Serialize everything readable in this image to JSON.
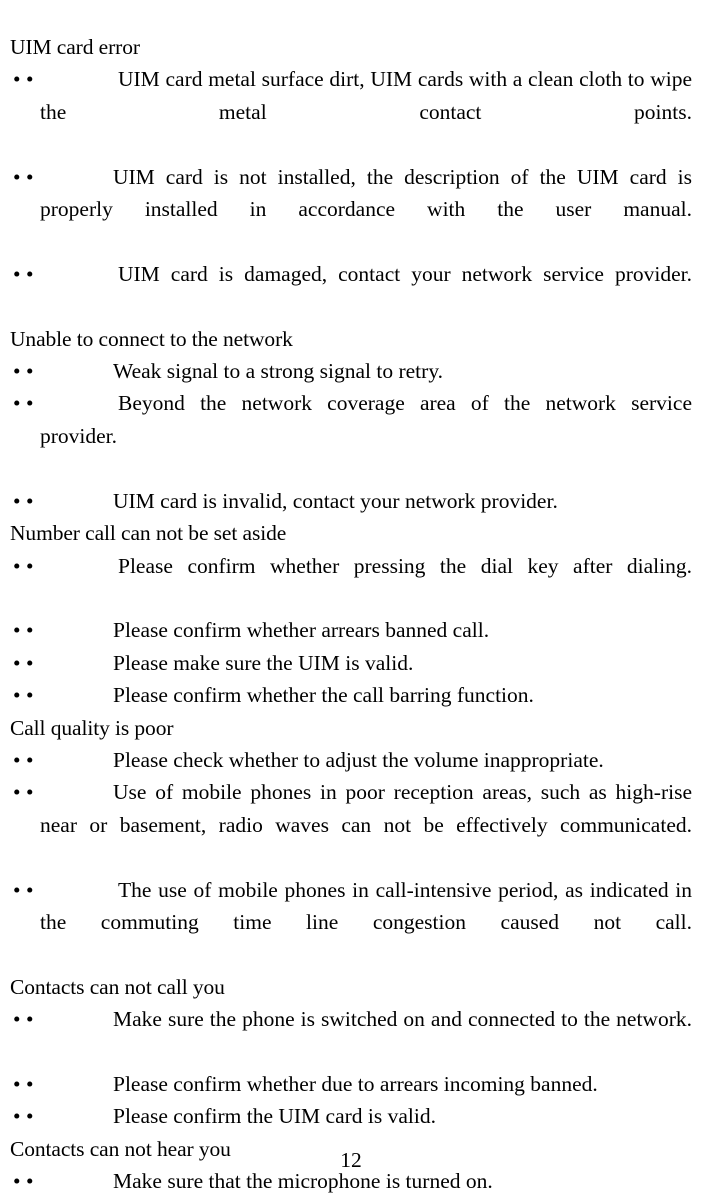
{
  "document": {
    "page_number": "12",
    "bullet_glyph": "•",
    "sections": [
      {
        "heading": "UIM card error",
        "items": [
          "UIM card metal surface dirt, UIM cards with a clean cloth to wipe the metal contact points.",
          "UIM card is not installed, the description of the UIM card is properly installed in accordance with the user manual.",
          "UIM card is damaged, contact your network service provider."
        ]
      },
      {
        "heading": "Unable to connect to the network",
        "items": [
          "Weak signal to a strong signal to retry.",
          "Beyond the network coverage area of the network service provider.",
          "UIM card is invalid, contact your network provider."
        ]
      },
      {
        "heading": "Number call can not be set aside",
        "items": [
          "Please confirm whether pressing the dial key after dialing.",
          "Please confirm whether arrears banned call.",
          "Please make sure the UIM is valid.",
          "Please confirm whether the call barring function."
        ]
      },
      {
        "heading": "Call quality is poor",
        "items": [
          "Please check whether to adjust the volume inappropriate.",
          "Use of mobile phones in poor reception areas, such as high-rise near or basement, radio waves can not be effectively communicated.",
          "The use of mobile phones in call-intensive period, as indicated in the commuting time line congestion caused not call."
        ]
      },
      {
        "heading": "Contacts can not call you",
        "items": [
          "Make sure the phone is switched on and connected to the network.",
          "Please confirm whether due to arrears incoming banned.",
          "Please confirm the UIM card is valid."
        ]
      },
      {
        "heading": "Contacts can not hear you",
        "items": [
          "Make sure that the microphone is turned on."
        ]
      }
    ]
  }
}
